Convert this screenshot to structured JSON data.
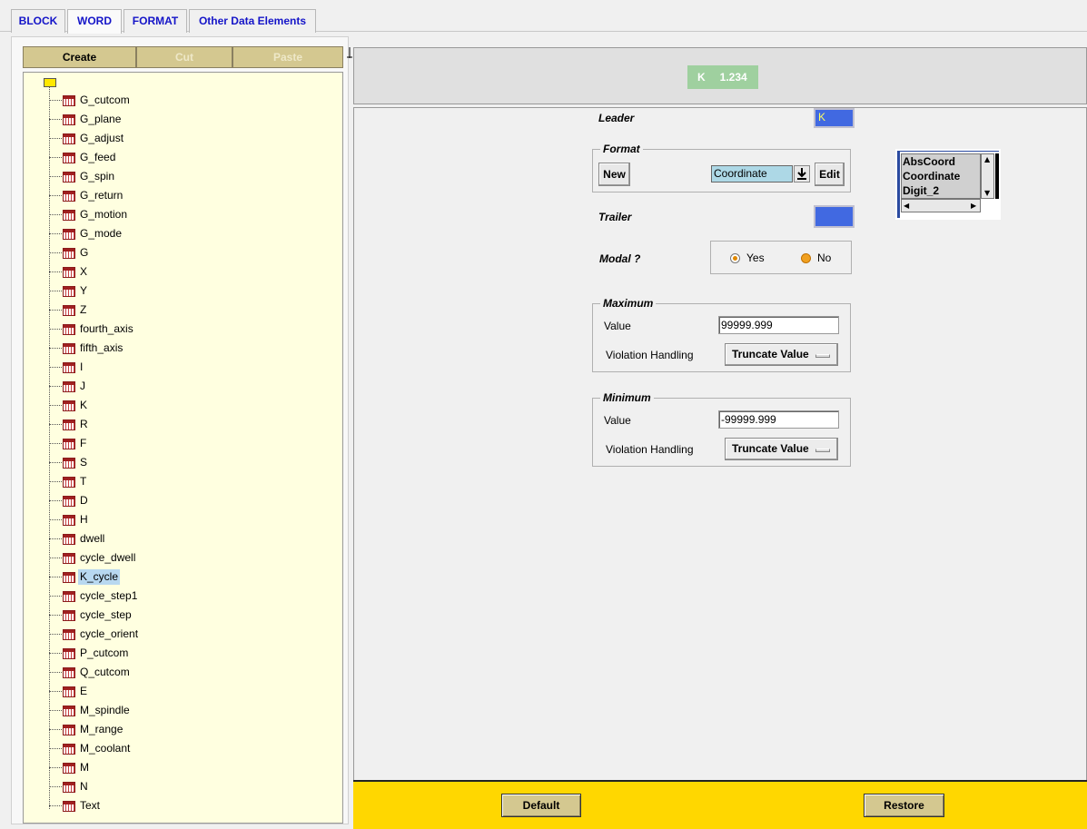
{
  "tabs": [
    {
      "label": "BLOCK"
    },
    {
      "label": "WORD"
    },
    {
      "label": "FORMAT"
    },
    {
      "label": "Other Data Elements"
    }
  ],
  "toolbar": {
    "create_label": "Create",
    "cut_label": "Cut",
    "paste_label": "Paste"
  },
  "tree": {
    "items": [
      "G_cutcom",
      "G_plane",
      "G_adjust",
      "G_feed",
      "G_spin",
      "G_return",
      "G_motion",
      "G_mode",
      "G",
      "X",
      "Y",
      "Z",
      "fourth_axis",
      "fifth_axis",
      "I",
      "J",
      "K",
      "R",
      "F",
      "S",
      "T",
      "D",
      "H",
      "dwell",
      "cycle_dwell",
      "K_cycle",
      "cycle_step1",
      "cycle_step",
      "cycle_orient",
      "P_cutcom",
      "Q_cutcom",
      "E",
      "M_spindle",
      "M_range",
      "M_coolant",
      "M",
      "N",
      "Text"
    ],
    "selected": "K_cycle"
  },
  "preview": {
    "leader": "K",
    "value": "1.234"
  },
  "form": {
    "leader_label": "Leader",
    "leader_value": "K",
    "format_group": "Format",
    "new_label": "New",
    "format_value": "Coordinate",
    "edit_label": "Edit",
    "trailer_label": "Trailer",
    "trailer_value": "",
    "modal_label": "Modal ?",
    "yes_label": "Yes",
    "no_label": "No",
    "maximum": {
      "title": "Maximum",
      "value_label": "Value",
      "value": "99999.999",
      "violation_label": "Violation Handling",
      "violation_value": "Truncate Value"
    },
    "minimum": {
      "title": "Minimum",
      "value_label": "Value",
      "value": "-99999.999",
      "violation_label": "Violation Handling",
      "violation_value": "Truncate Value"
    }
  },
  "format_list": [
    "AbsCoord",
    "Coordinate",
    "Digit_2"
  ],
  "bottom": {
    "default_label": "Default",
    "restore_label": "Restore"
  },
  "colors": {
    "accent_yellow": "#ffd700",
    "leader_blue": "#4169e1",
    "tree_bg": "#ffffe0",
    "preview_green": "#9fd09f"
  }
}
